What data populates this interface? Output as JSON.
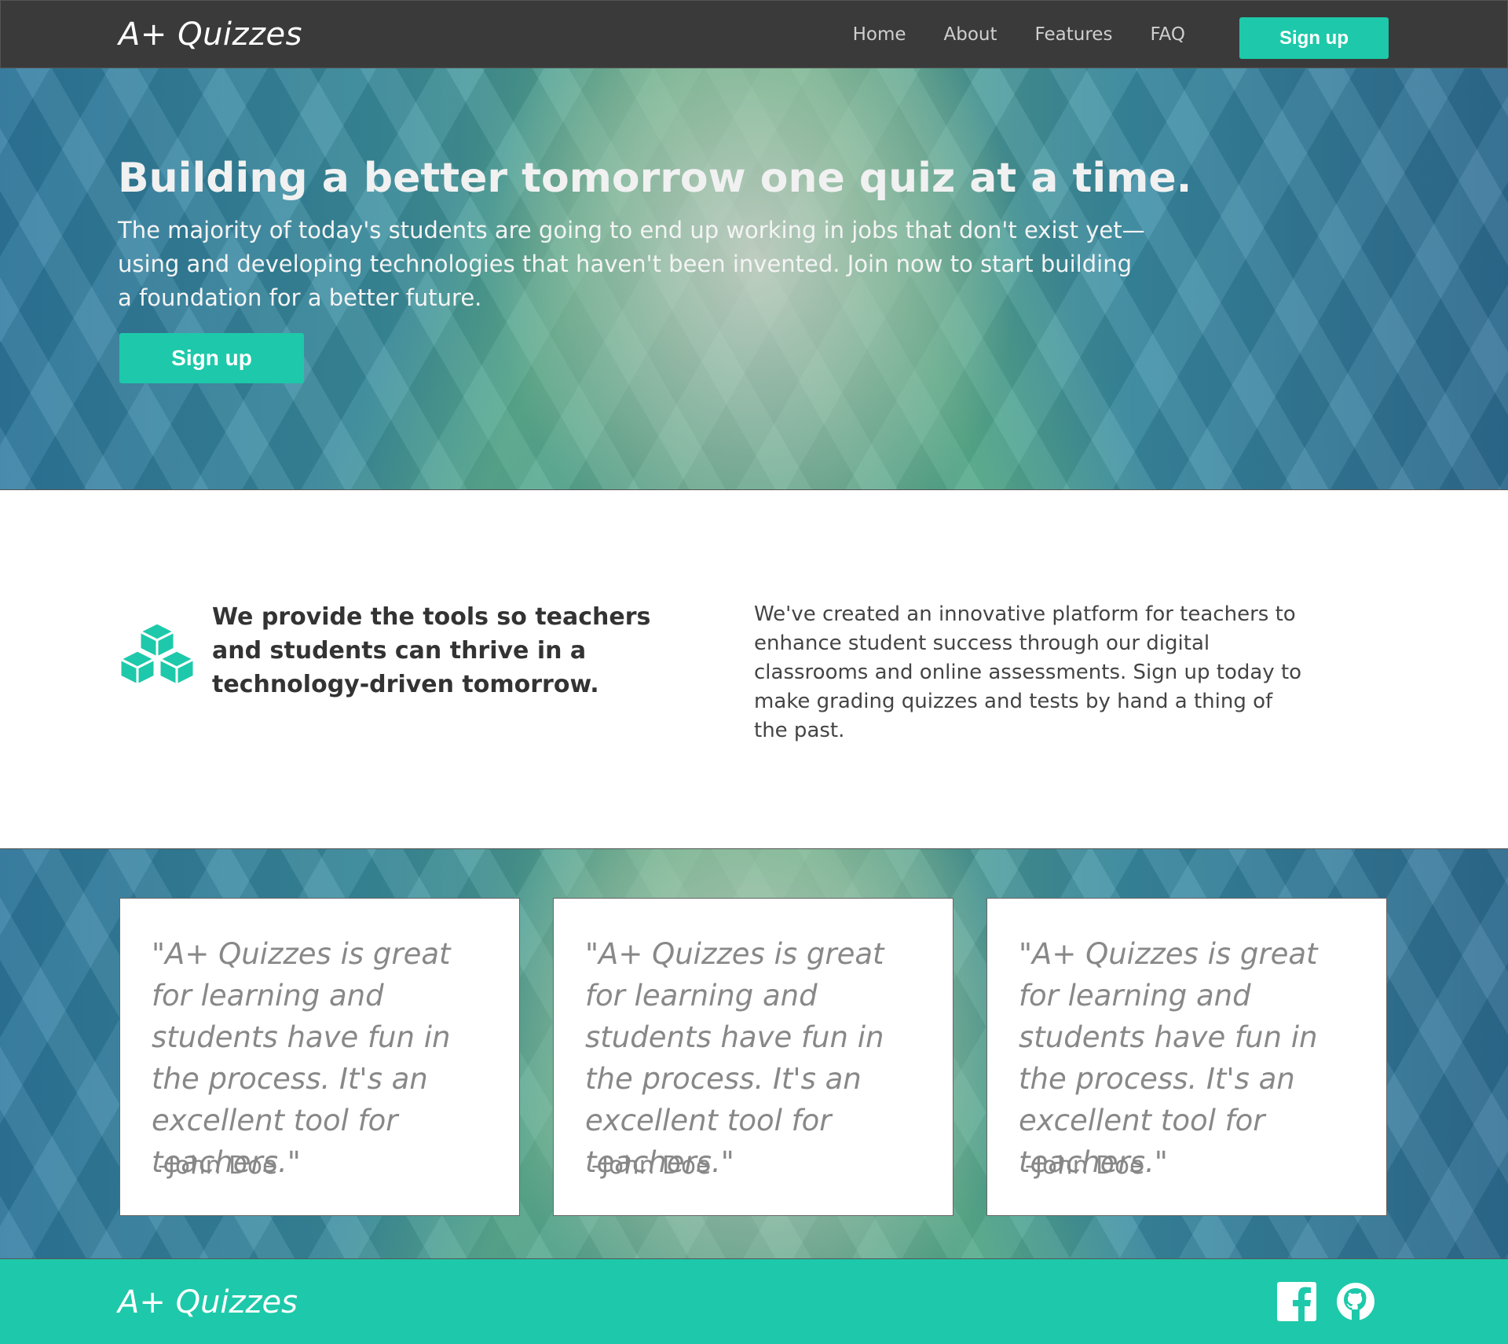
{
  "navbar": {
    "brand": "A+ Quizzes",
    "links": [
      "Home",
      "About",
      "Features",
      "FAQ"
    ],
    "signup_label": "Sign up"
  },
  "hero": {
    "title": "Building a better tomorrow one quiz at a time.",
    "text": "The majority of today's students are going to end up working in jobs that don't exist yet—using and developing technologies that haven't been invented. Join now to start building a foundation for a better future.",
    "signup_label": "Sign up"
  },
  "feature": {
    "icon": "cubes-icon",
    "heading": "We provide the tools so teachers and students can thrive in a technology-driven tomorrow.",
    "text": "We've created an innovative platform for teachers to enhance student success through our digital classrooms and online assessments. Sign up today to make grading quizzes and tests by hand a thing of the past."
  },
  "testimonials": [
    {
      "quote": "\"A+ Quizzes is great for learning and students have fun in the process. It's an excellent tool for teachers.\"",
      "author": "-John Doe"
    },
    {
      "quote": "\"A+ Quizzes is great for learning and students have fun in the process. It's an excellent tool for teachers.\"",
      "author": "-John Doe"
    },
    {
      "quote": "\"A+ Quizzes is great for learning and students have fun in the process. It's an excellent tool for teachers.\"",
      "author": "-John Doe"
    }
  ],
  "footer": {
    "brand": "A+ Quizzes",
    "social_icons": [
      "facebook-icon",
      "github-icon"
    ]
  },
  "colors": {
    "accent": "#1dc9aa",
    "navbar": "#3a3a3a"
  }
}
